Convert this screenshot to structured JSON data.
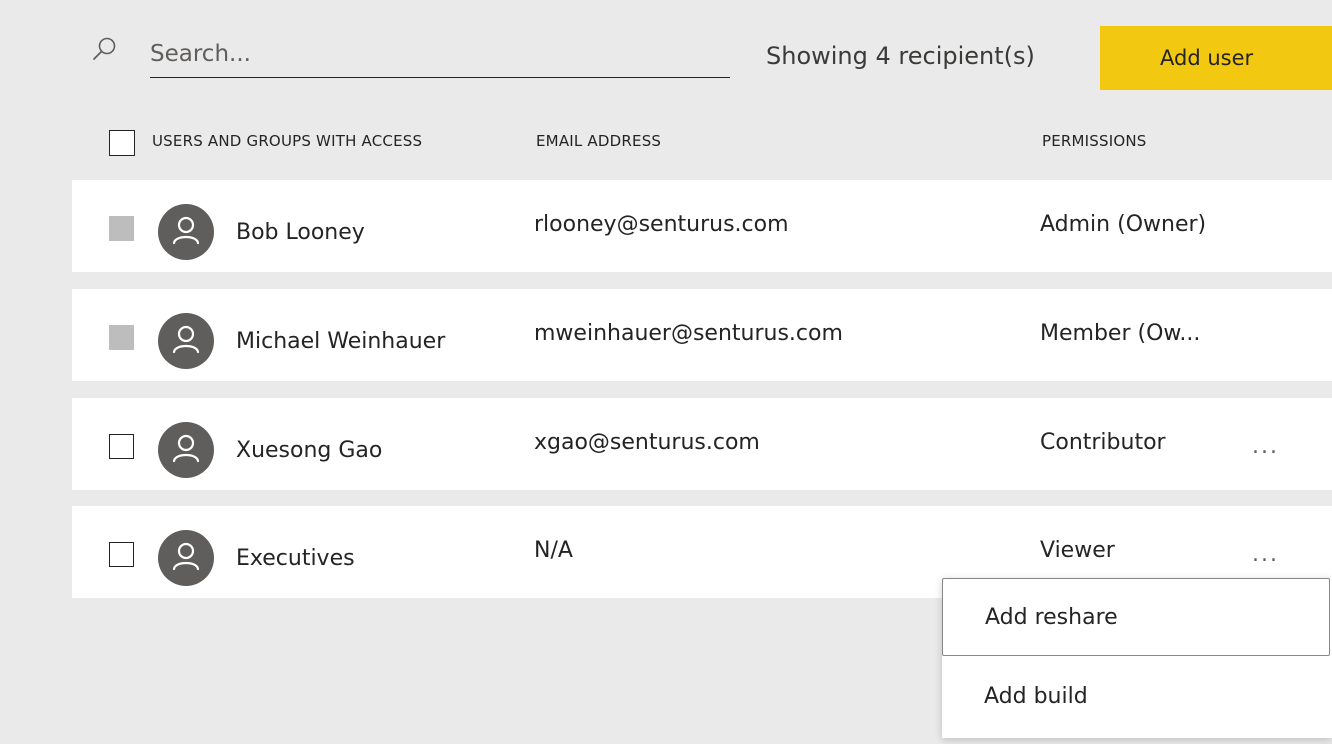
{
  "search": {
    "placeholder": "Search...",
    "value": ""
  },
  "toolbar": {
    "recipient_count": "Showing 4 recipient(s)",
    "add_user_label": "Add user",
    "accent_color": "#f2c811"
  },
  "table": {
    "columns": {
      "users": "USERS AND GROUPS WITH ACCESS",
      "email": "EMAIL ADDRESS",
      "permissions": "PERMISSIONS"
    },
    "rows": [
      {
        "name": "Bob Looney",
        "email": "rlooney@senturus.com",
        "permission": "Admin (Owner)",
        "checkbox": "disabled",
        "more": ""
      },
      {
        "name": "Michael Weinhauer",
        "email": "mweinhauer@senturus.com",
        "permission": "Member (Ow...",
        "checkbox": "disabled",
        "more": ""
      },
      {
        "name": "Xuesong Gao",
        "email": "xgao@senturus.com",
        "permission": "Contributor",
        "checkbox": "empty",
        "more": "..."
      },
      {
        "name": "Executives",
        "email": "N/A",
        "permission": "Viewer",
        "checkbox": "empty",
        "more": "..."
      }
    ]
  },
  "context_menu": {
    "items": [
      {
        "label": "Add reshare"
      },
      {
        "label": "Add build"
      }
    ]
  },
  "icons": {
    "search": "search-icon",
    "avatar": "person-icon",
    "more": "more-options-icon"
  }
}
